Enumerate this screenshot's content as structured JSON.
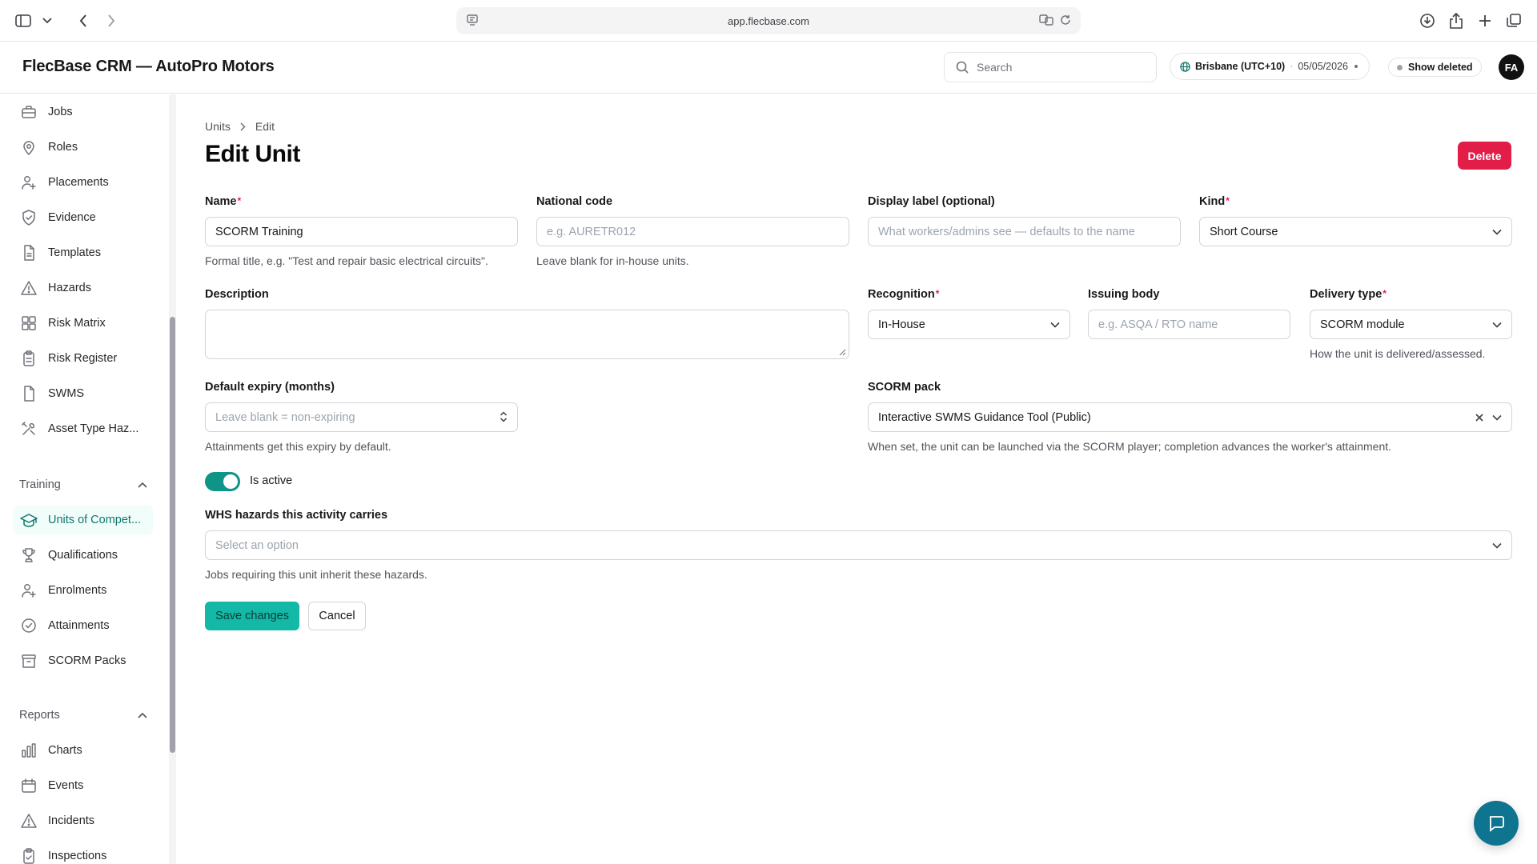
{
  "browser": {
    "url": "app.flecbase.com"
  },
  "app": {
    "title": "FlecBase CRM — AutoPro Motors",
    "search_placeholder": "Search",
    "timezone": "Brisbane (UTC+10)",
    "date": "05/05/2026",
    "show_deleted": "Show deleted",
    "avatar_initials": "FA"
  },
  "sidebar": {
    "items_top": [
      {
        "label": "Jobs",
        "icon": "briefcase-icon"
      },
      {
        "label": "Roles",
        "icon": "map-pin-icon"
      },
      {
        "label": "Placements",
        "icon": "user-plus-icon"
      },
      {
        "label": "Evidence",
        "icon": "shield-check-icon"
      },
      {
        "label": "Templates",
        "icon": "file-icon"
      },
      {
        "label": "Hazards",
        "icon": "warning-triangle-icon"
      },
      {
        "label": "Risk Matrix",
        "icon": "grid-icon"
      },
      {
        "label": "Risk Register",
        "icon": "clipboard-icon"
      },
      {
        "label": "SWMS",
        "icon": "document-icon"
      },
      {
        "label": "Asset Type Haz...",
        "icon": "tools-icon"
      }
    ],
    "group_training": "Training",
    "items_training": [
      {
        "label": "Units of Compet...",
        "icon": "graduation-cap-icon"
      },
      {
        "label": "Qualifications",
        "icon": "trophy-icon"
      },
      {
        "label": "Enrolments",
        "icon": "user-plus-icon"
      },
      {
        "label": "Attainments",
        "icon": "check-circle-icon"
      },
      {
        "label": "SCORM Packs",
        "icon": "archive-icon"
      }
    ],
    "group_reports": "Reports",
    "items_reports": [
      {
        "label": "Charts",
        "icon": "bar-chart-icon"
      },
      {
        "label": "Events",
        "icon": "calendar-icon"
      },
      {
        "label": "Incidents",
        "icon": "warning-triangle-icon"
      },
      {
        "label": "Inspections",
        "icon": "clipboard-check-icon"
      }
    ]
  },
  "page": {
    "breadcrumb": [
      "Units",
      "Edit"
    ],
    "title": "Edit Unit",
    "delete_label": "Delete"
  },
  "form": {
    "name": {
      "label": "Name",
      "value": "SCORM Training",
      "help": "Formal title, e.g. \"Test and repair basic electrical circuits\"."
    },
    "national_code": {
      "label": "National code",
      "placeholder": "e.g. AURETR012",
      "help": "Leave blank for in-house units."
    },
    "display_label": {
      "label": "Display label (optional)",
      "placeholder": "What workers/admins see — defaults to the name"
    },
    "kind": {
      "label": "Kind",
      "value": "Short Course"
    },
    "description": {
      "label": "Description",
      "value": ""
    },
    "recognition": {
      "label": "Recognition",
      "value": "In-House"
    },
    "issuing_body": {
      "label": "Issuing body",
      "placeholder": "e.g. ASQA / RTO name"
    },
    "delivery_type": {
      "label": "Delivery type",
      "value": "SCORM module",
      "help": "How the unit is delivered/assessed."
    },
    "default_expiry": {
      "label": "Default expiry (months)",
      "placeholder": "Leave blank = non-expiring",
      "help": "Attainments get this expiry by default."
    },
    "scorm_pack": {
      "label": "SCORM pack",
      "value": "Interactive SWMS Guidance Tool (Public)",
      "help": "When set, the unit can be launched via the SCORM player; completion advances the worker's attainment."
    },
    "is_active": {
      "label": "Is active",
      "value": true
    },
    "whs_hazards": {
      "label": "WHS hazards this activity carries",
      "placeholder": "Select an option",
      "help": "Jobs requiring this unit inherit these hazards."
    },
    "save_label": "Save changes",
    "cancel_label": "Cancel"
  },
  "colors": {
    "accent": "#14b8a6",
    "danger": "#e11d48",
    "active_nav": "#0f766e"
  }
}
